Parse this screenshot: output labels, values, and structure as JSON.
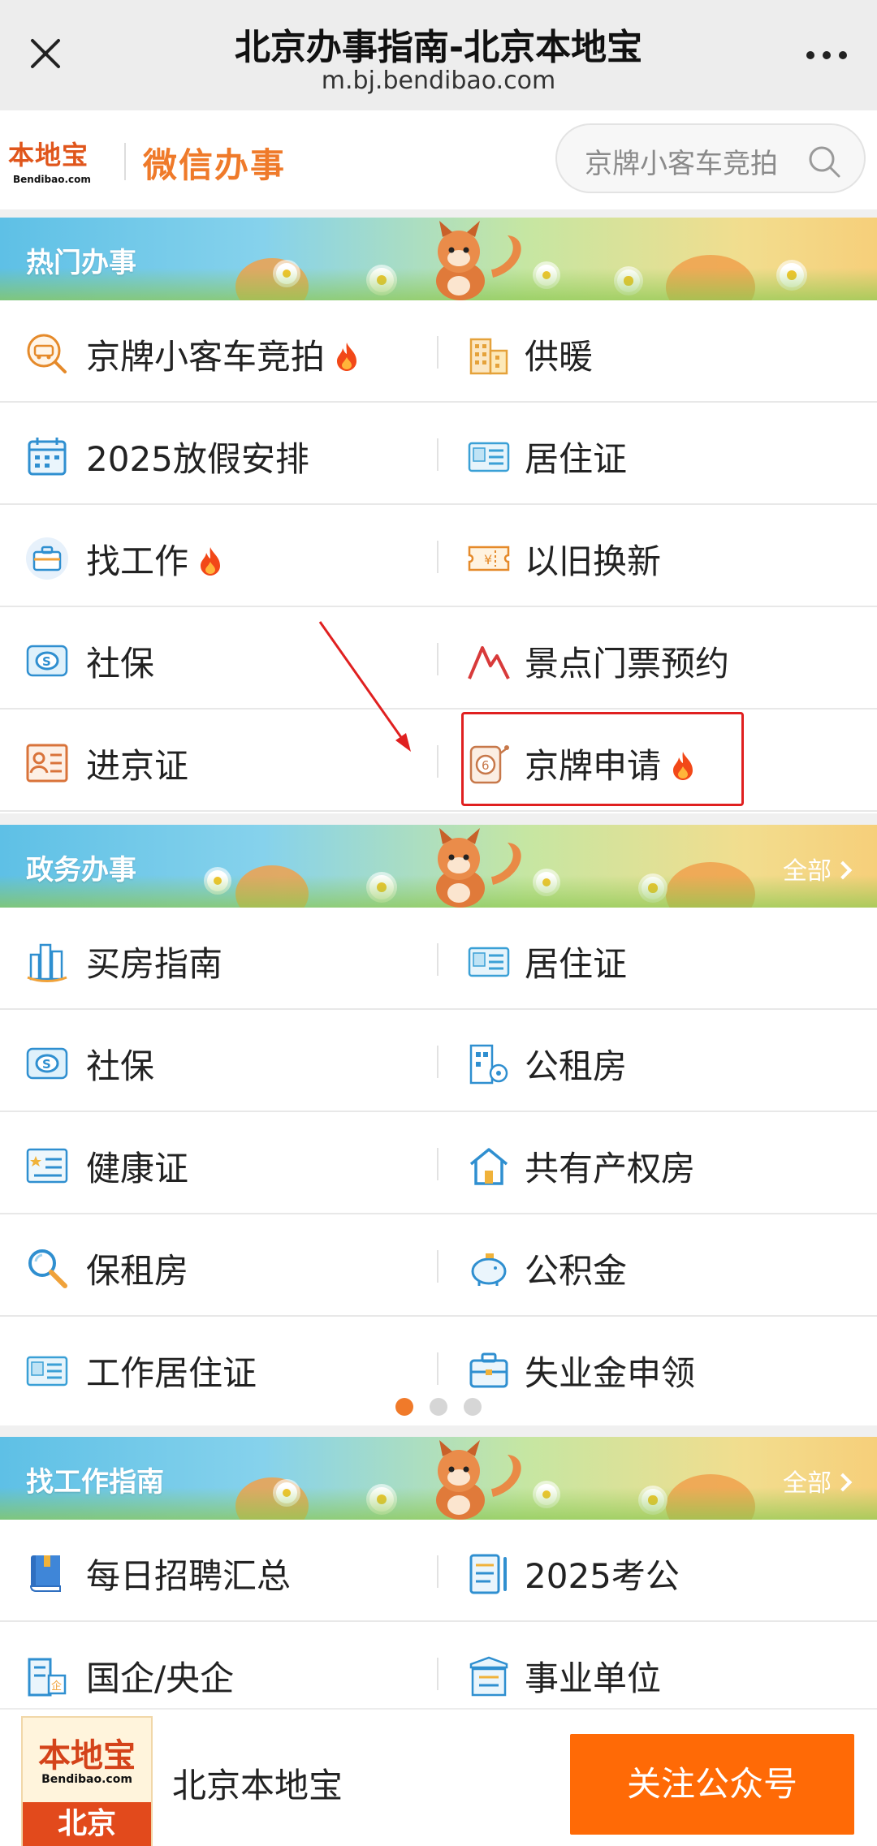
{
  "header": {
    "title": "北京办事指南-北京本地宝",
    "url": "m.bj.bendibao.com"
  },
  "brand": {
    "logo_cn": "本地宝",
    "logo_en": "Bendibao.com",
    "name": "微信办事",
    "search_placeholder": "京牌小客车竞拍"
  },
  "sections": {
    "hot": {
      "title": "热门办事",
      "items": [
        {
          "label": "京牌小客车竞拍",
          "hot": true,
          "icon": "car-auction-icon"
        },
        {
          "label": "供暖",
          "hot": false,
          "icon": "building-icon"
        },
        {
          "label": "2025放假安排",
          "hot": false,
          "icon": "calendar-icon"
        },
        {
          "label": "居住证",
          "hot": false,
          "icon": "residence-card-icon"
        },
        {
          "label": "找工作",
          "hot": true,
          "icon": "briefcase-icon"
        },
        {
          "label": "以旧换新",
          "hot": false,
          "icon": "coupon-icon"
        },
        {
          "label": "社保",
          "hot": false,
          "icon": "social-security-icon"
        },
        {
          "label": "景点门票预约",
          "hot": false,
          "icon": "mountain-icon"
        },
        {
          "label": "进京证",
          "hot": false,
          "icon": "id-card-icon"
        },
        {
          "label": "京牌申请",
          "hot": true,
          "icon": "license-lottery-icon"
        }
      ]
    },
    "gov": {
      "title": "政务办事",
      "all_label": "全部",
      "items": [
        {
          "label": "买房指南",
          "icon": "buildings-icon"
        },
        {
          "label": "居住证",
          "icon": "residence-card-icon"
        },
        {
          "label": "社保",
          "icon": "social-security-icon"
        },
        {
          "label": "公租房",
          "icon": "rent-house-icon"
        },
        {
          "label": "健康证",
          "icon": "health-card-icon"
        },
        {
          "label": "共有产权房",
          "icon": "house-icon"
        },
        {
          "label": "保租房",
          "icon": "magnifier-icon"
        },
        {
          "label": "公积金",
          "icon": "piggy-bank-icon"
        },
        {
          "label": "工作居住证",
          "icon": "residence-card-icon"
        },
        {
          "label": "失业金申领",
          "icon": "briefcase-icon"
        }
      ],
      "pager": {
        "pages": 3,
        "current": 1
      }
    },
    "job": {
      "title": "找工作指南",
      "all_label": "全部",
      "items": [
        {
          "label": "每日招聘汇总",
          "icon": "book-icon"
        },
        {
          "label": "2025考公",
          "icon": "notepad-icon"
        },
        {
          "label": "国企/央企",
          "icon": "enterprise-icon"
        },
        {
          "label": "事业单位",
          "icon": "institution-icon"
        }
      ]
    }
  },
  "footer": {
    "logo_cn": "本地宝",
    "logo_en": "Bendibao.com",
    "logo_city": "北京",
    "name": "北京本地宝",
    "follow_label": "关注公众号"
  },
  "colors": {
    "accent": "#ff6a06",
    "brand": "#ef7a2a",
    "icon_blue": "#2f8fd0",
    "icon_orange": "#e58a2a",
    "highlight": "#e02020"
  }
}
